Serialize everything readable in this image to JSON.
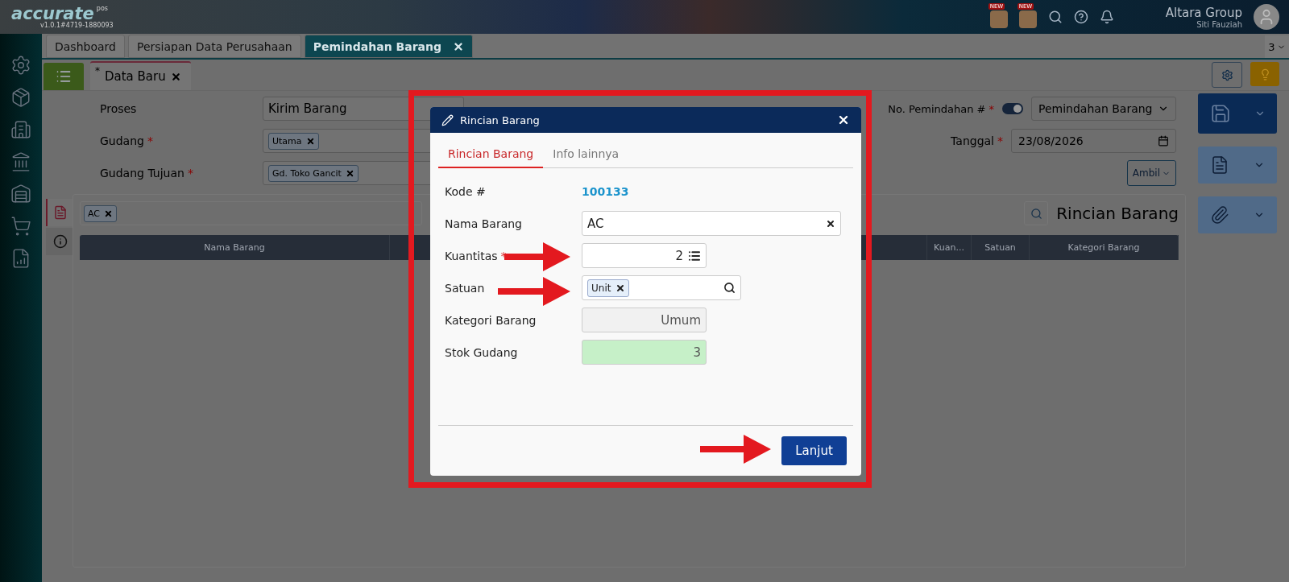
{
  "header": {
    "logo": "accurate",
    "logo_tag": "pos",
    "version": "v1.0.1#4719-1880093",
    "badges": [
      "NEW",
      "NEW"
    ],
    "company": "Altara Group",
    "user": "Siti Fauziah"
  },
  "tabs": [
    {
      "label": "Dashboard",
      "selected": false,
      "closable": false
    },
    {
      "label": "Persiapan Data Perusahaan",
      "selected": false,
      "closable": false
    },
    {
      "label": "Pemindahan Barang",
      "selected": true,
      "closable": true
    }
  ],
  "tab_count": "3",
  "sub_tab": {
    "mark": "*",
    "label": "Data Baru"
  },
  "form": {
    "fields": [
      {
        "label": "Proses",
        "required": false,
        "kind": "select",
        "value": "Kirim Barang"
      },
      {
        "label": "Gudang",
        "required": true,
        "kind": "tags",
        "tags": [
          "Utama"
        ]
      },
      {
        "label": "Gudang Tujuan",
        "required": true,
        "kind": "tags",
        "tags": [
          "Gd. Toko Gancit"
        ]
      }
    ],
    "number": {
      "label": "No. Pemindahan #",
      "required": true,
      "auto": true,
      "value": "Pemindahan Barang"
    },
    "date": {
      "label": "Tanggal",
      "required": true,
      "value": "23/08/2026"
    },
    "ambil": "Ambil"
  },
  "detail": {
    "search_tags": [
      "AC"
    ],
    "title": "Rincian Barang",
    "columns": [
      "Nama Barang",
      "Kuan...",
      "Satuan",
      "Kategori Barang"
    ]
  },
  "modal": {
    "title": "Rincian Barang",
    "tabs": [
      {
        "label": "Rincian Barang",
        "selected": true
      },
      {
        "label": "Info lainnya",
        "selected": false
      }
    ],
    "rows": [
      {
        "kind": "link",
        "label": "Kode #",
        "required": false,
        "value": "100133"
      },
      {
        "kind": "input",
        "label": "Nama Barang",
        "required": false,
        "value": "AC"
      },
      {
        "kind": "number",
        "label": "Kuantitas",
        "required": true,
        "value": "2"
      },
      {
        "kind": "tags",
        "label": "Satuan",
        "required": false,
        "tags": [
          "Unit"
        ]
      },
      {
        "kind": "readonly",
        "label": "Kategori Barang",
        "required": false,
        "value": "Umum"
      },
      {
        "kind": "stock",
        "label": "Stok Gudang",
        "required": false,
        "value": "3"
      }
    ],
    "button": "Lanjut"
  }
}
